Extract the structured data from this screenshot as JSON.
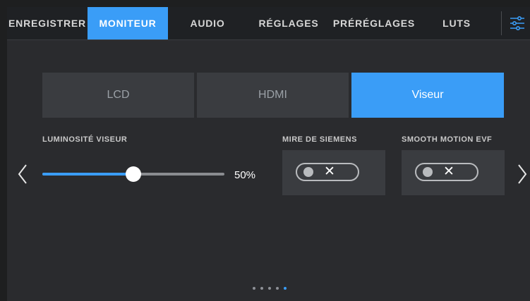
{
  "tabs": [
    {
      "label": "ENREGISTRER",
      "active": false
    },
    {
      "label": "MONITEUR",
      "active": true
    },
    {
      "label": "AUDIO",
      "active": false
    },
    {
      "label": "RÉGLAGES",
      "active": false
    },
    {
      "label": "PRÉRÉGLAGES",
      "active": false
    },
    {
      "label": "LUTS",
      "active": false
    }
  ],
  "menu_icon": "sliders-icon",
  "segments": [
    {
      "label": "LCD",
      "active": false
    },
    {
      "label": "HDMI",
      "active": false
    },
    {
      "label": "Viseur",
      "active": true
    }
  ],
  "brightness": {
    "label": "LUMINOSITÉ VISEUR",
    "value": 50,
    "value_text": "50%"
  },
  "siemens": {
    "label": "MIRE DE SIEMENS",
    "state": "off",
    "toggle_glyph": "✕"
  },
  "smooth_motion": {
    "label": "SMOOTH MOTION EVF",
    "state": "off",
    "toggle_glyph": "✕"
  },
  "pagination": {
    "total": 5,
    "current": 5
  },
  "nav_icons": {
    "prev": "chevron-left-icon",
    "next": "chevron-right-icon"
  },
  "colors": {
    "accent": "#3a9df7",
    "panel": "#2a2b2e",
    "control": "#3a3c40"
  }
}
